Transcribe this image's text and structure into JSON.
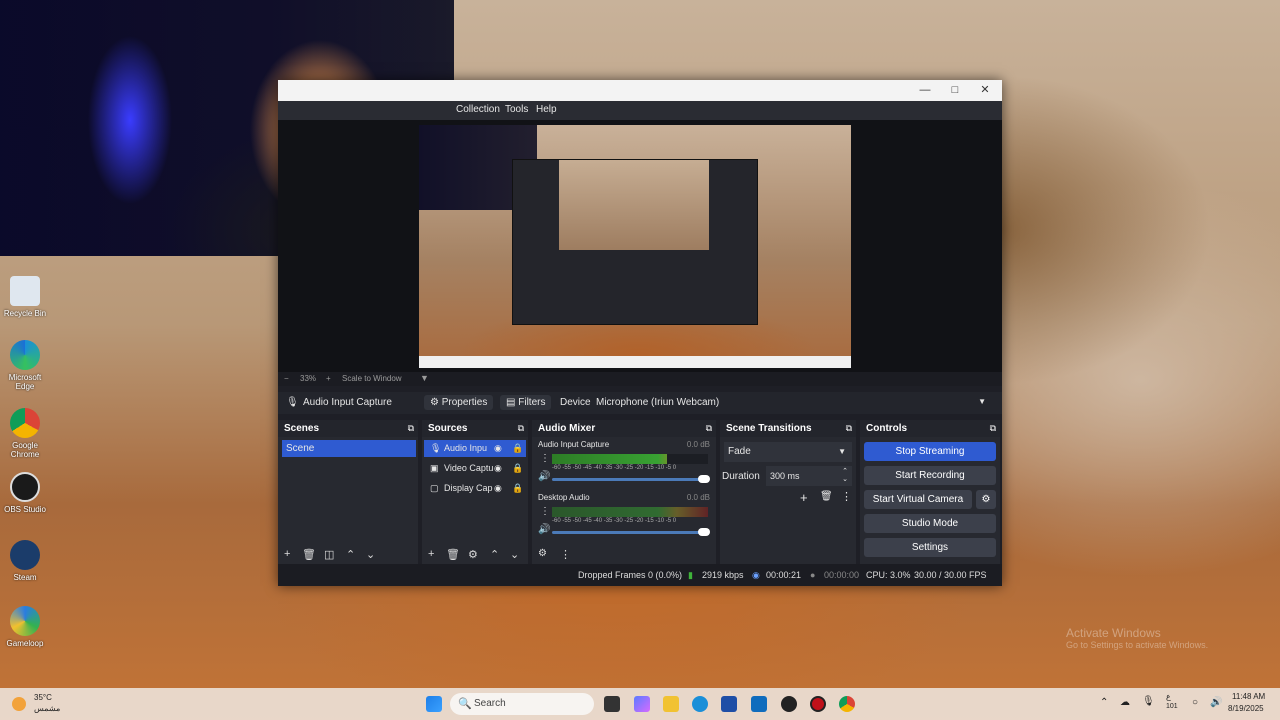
{
  "desktop": {
    "icons": [
      {
        "label": "Recycle Bin"
      },
      {
        "label": "Microsoft Edge"
      },
      {
        "label": "Google Chrome"
      },
      {
        "label": "OBS Studio"
      },
      {
        "label": "Steam"
      },
      {
        "label": "Gameloop"
      }
    ],
    "watermark_title": "Activate Windows",
    "watermark_sub": "Go to Settings to activate Windows."
  },
  "obs": {
    "menu": [
      "Collection",
      "Tools",
      "Help"
    ],
    "zoom": {
      "level": "33%",
      "scale_label": "Scale to Window"
    },
    "source_bar": {
      "selected_source": "Audio Input Capture",
      "properties_label": "Properties",
      "filters_label": "Filters",
      "device_label": "Device",
      "device_value": "Microphone (Iriun Webcam)"
    },
    "scenes": {
      "title": "Scenes",
      "items": [
        "Scene"
      ]
    },
    "sources": {
      "title": "Sources",
      "items": [
        "Audio Inpu",
        "Video Captu",
        "Display Cap"
      ]
    },
    "mixer": {
      "title": "Audio Mixer",
      "channels": [
        {
          "name": "Audio Input Capture",
          "db": "0.0 dB",
          "level": 0.74,
          "volume": 1.0
        },
        {
          "name": "Desktop Audio",
          "db": "0.0 dB",
          "level": 0.0,
          "volume": 1.0
        }
      ],
      "scale": "-60 -55 -50 -45 -40 -35 -30 -25 -20 -15 -10 -5 0"
    },
    "transitions": {
      "title": "Scene Transitions",
      "type": "Fade",
      "duration_label": "Duration",
      "duration_value": "300 ms"
    },
    "controls": {
      "title": "Controls",
      "stop_streaming": "Stop Streaming",
      "start_recording": "Start Recording",
      "start_virtual_camera": "Start Virtual Camera",
      "studio_mode": "Studio Mode",
      "settings": "Settings"
    },
    "status": {
      "dropped_frames": "Dropped Frames 0 (0.0%)",
      "bitrate": "2919 kbps",
      "stream_time": "00:00:21",
      "record_time": "00:00:00",
      "cpu": "CPU: 3.0%",
      "fps": "30.00 / 30.00 FPS"
    }
  },
  "taskbar": {
    "weather_temp": "35°C",
    "weather_desc": "مشمس",
    "search_placeholder": "Search",
    "lang": "ع",
    "lang_sub": "101",
    "time": "11:48 AM",
    "date": "8/19/2025"
  },
  "colors": {
    "obs_accent": "#2f5bd1",
    "obs_bg": "#1e1f26",
    "meter_green": "#38a132"
  }
}
